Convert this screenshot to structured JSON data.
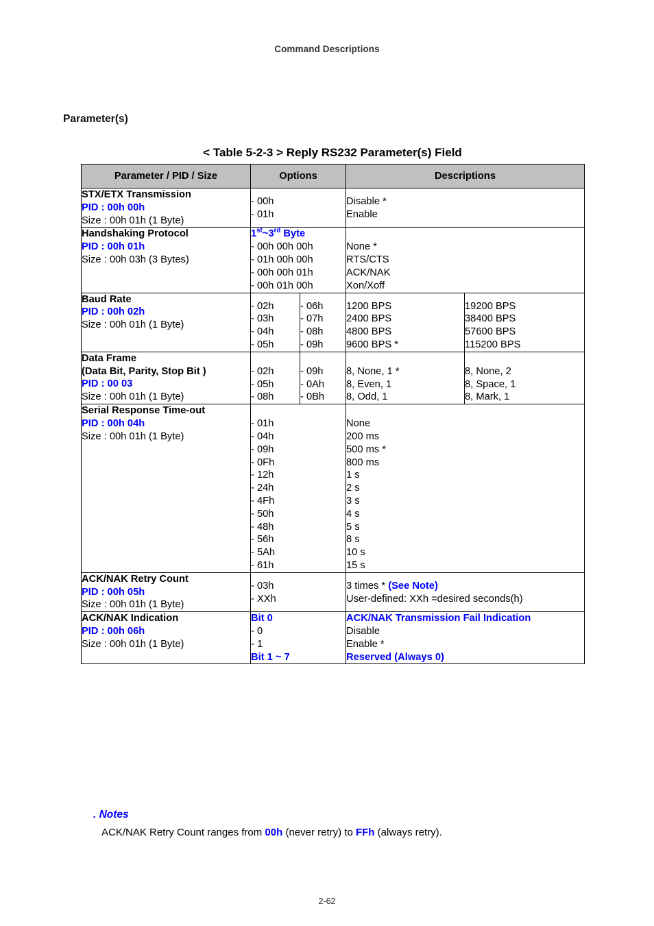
{
  "running_head": "Command Descriptions",
  "section_heading": "Parameter(s)",
  "table_caption": "< Table 5-2-3 > Reply RS232 Parameter(s) Field",
  "colors": {
    "accent_blue": "#0000FF",
    "header_fill": "#C0C0C0",
    "border": "#000000",
    "text": "#000000"
  },
  "table": {
    "headers": {
      "col1": "Parameter / PID / Size",
      "col2": "Options",
      "col3": "Descriptions"
    },
    "rows": [
      {
        "name": "stx-etx-transmission",
        "param_title": "STX/ETX Transmission",
        "pid": "PID : 00h 00h",
        "size": "Size : 00h 01h (1 Byte)",
        "options": [
          "- 00h",
          "- 01h"
        ],
        "descriptions": [
          "Disable *",
          "Enable"
        ]
      },
      {
        "name": "handshaking-protocol",
        "param_title": "Handshaking Protocol",
        "pid": "PID : 00h 01h",
        "size": "Size : 00h 03h (3 Bytes)",
        "options_heading": "1st~3rd Byte",
        "options_heading_parts": {
          "a": "1",
          "sup_a": "st",
          "mid": "~3",
          "sup_b": "rd",
          "b": " Byte"
        },
        "options": [
          "- 00h 00h 00h",
          "- 01h 00h 00h",
          "- 00h 00h 01h",
          "- 00h 01h 00h"
        ],
        "descriptions": [
          "None *",
          "RTS/CTS",
          "ACK/NAK",
          "Xon/Xoff"
        ]
      },
      {
        "name": "baud-rate",
        "param_title": "Baud Rate",
        "pid": "PID : 00h 02h",
        "size": "Size : 00h 01h (1 Byte)",
        "options_a": [
          "- 02h",
          "- 03h",
          "- 04h",
          "- 05h"
        ],
        "options_b": [
          "- 06h",
          "- 07h",
          "- 08h",
          "- 09h"
        ],
        "descriptions_a": [
          "1200 BPS",
          "2400 BPS",
          "4800 BPS",
          "9600 BPS *"
        ],
        "descriptions_b": [
          "19200 BPS",
          "38400 BPS",
          "57600 BPS",
          "115200 BPS"
        ]
      },
      {
        "name": "data-frame",
        "param_title": "Data Frame",
        "param_subtitle": "(Data Bit, Parity, Stop Bit )",
        "pid": "PID : 00 03",
        "size": "Size : 00h 01h (1 Byte)",
        "options_a": [
          "- 02h",
          "- 05h",
          "- 08h"
        ],
        "options_b": [
          "- 09h",
          "- 0Ah",
          "- 0Bh"
        ],
        "descriptions_a": [
          "8, None, 1 *",
          "8, Even, 1",
          "8, Odd, 1"
        ],
        "descriptions_b": [
          "8, None, 2",
          "8, Space, 1",
          "8, Mark, 1"
        ]
      },
      {
        "name": "serial-response-time-out",
        "param_title": "Serial Response Time-out",
        "pid": "PID : 00h 04h",
        "size": "Size : 00h 01h (1 Byte)",
        "options": [
          "- 01h",
          "- 04h",
          "- 09h",
          "- 0Fh",
          "- 12h",
          "- 24h",
          "- 4Fh",
          "- 50h",
          "- 48h",
          "- 56h",
          "- 5Ah",
          "- 61h"
        ],
        "descriptions": [
          "None",
          "200 ms",
          "500 ms *",
          "800 ms",
          "1 s",
          "2 s",
          "3 s",
          "4 s",
          "5 s",
          "8 s",
          "10 s",
          "15 s"
        ]
      },
      {
        "name": "ack-nak-retry-count",
        "param_title": "ACK/NAK Retry Count",
        "pid": "PID : 00h 05h",
        "size": "Size : 00h 01h (1 Byte)",
        "options": [
          "- 03h",
          "- XXh"
        ],
        "desc_line1_plain": "3 times * ",
        "desc_line1_blue": "(See Note)",
        "desc_line2": "User-defined: XXh =desired seconds(h)"
      },
      {
        "name": "ack-nak-indication",
        "param_title": "ACK/NAK Indication",
        "pid": "PID : 00h 06h",
        "size": "Size : 00h 01h (1 Byte)",
        "options_blue_1": "Bit 0",
        "options_mid": [
          "- 0",
          "- 1"
        ],
        "options_blue_2": "Bit 1 ~ 7",
        "desc_blue_1": "ACK/NAK Transmission Fail Indication",
        "desc_mid": [
          "Disable",
          "Enable *"
        ],
        "desc_blue_2": "Reserved (Always 0)"
      }
    ]
  },
  "notes": {
    "title": ". Notes",
    "body_pre": "ACK/NAK Retry Count ranges from ",
    "body_b1": "00h",
    "body_mid": " (never retry) to ",
    "body_b2": "FFh",
    "body_post": " (always retry)."
  },
  "footer": {
    "page_number": "2-62"
  }
}
